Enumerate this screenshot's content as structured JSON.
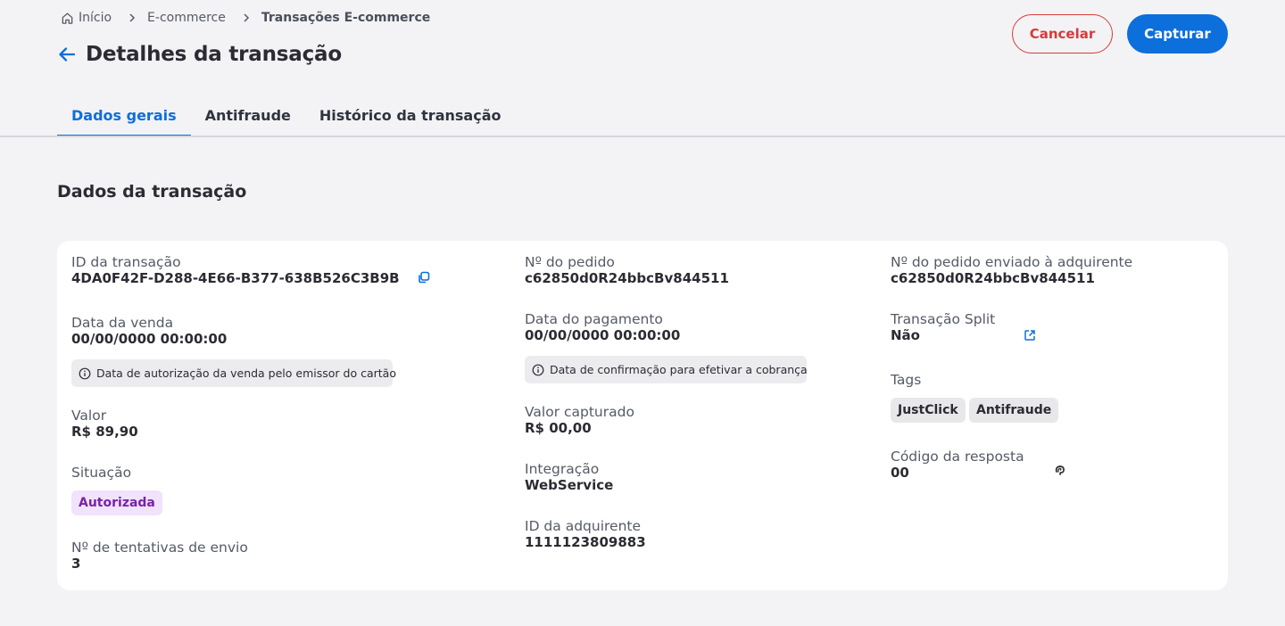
{
  "breadcrumb": {
    "home": "Início",
    "level1": "E-commerce",
    "current": "Transações E-commerce"
  },
  "header": {
    "title": "Detalhes da transação",
    "cancel_label": "Cancelar",
    "capture_label": "Capturar"
  },
  "tabs": [
    {
      "label": "Dados gerais",
      "active": true
    },
    {
      "label": "Antifraude",
      "active": false
    },
    {
      "label": "Histórico da transação",
      "active": false
    }
  ],
  "section": {
    "title": "Dados da transação"
  },
  "col1": {
    "transaction_id_label": "ID da transação",
    "transaction_id": "4DA0F42F-D288-4E66-B377-638B526C3B9B",
    "sale_date_label": "Data da venda",
    "sale_date": "00/00/0000 00:00:00",
    "sale_date_info": "Data de autorização da venda pelo emissor do cartão",
    "amount_label": "Valor",
    "amount": "R$ 89,90",
    "status_label": "Situação",
    "status": "Autorizada",
    "attempts_label": "Nº de tentativas de envio",
    "attempts": "3"
  },
  "col2": {
    "order_label": "Nº do pedido",
    "order": "c62850d0R24bbcBv844511",
    "payment_date_label": "Data do pagamento",
    "payment_date": "00/00/0000 00:00:00",
    "payment_date_info": "Data de confirmação para efetivar a cobrança",
    "captured_label": "Valor capturado",
    "captured": "R$ 00,00",
    "integration_label": "Integração",
    "integration": "WebService",
    "acquirer_id_label": "ID da adquirente",
    "acquirer_id": "1111123809883"
  },
  "col3": {
    "acq_order_label": "Nº do pedido enviado à adquirente",
    "acq_order": "c62850d0R24bbcBv844511",
    "split_label": "Transação Split",
    "split": "Não",
    "tags_label": "Tags",
    "tags": [
      "JustClick",
      "Antifraude"
    ],
    "response_code_label": "Código da resposta",
    "response_code": "00"
  },
  "colors": {
    "primary": "#0c6fdb",
    "danger": "#d63b3b",
    "status_bg": "#f1e3fb",
    "status_text": "#7a21a8"
  },
  "icons": {
    "home": "home-icon",
    "chevron": "chevron-right-icon",
    "back": "arrow-left-icon",
    "copy": "copy-icon",
    "info": "info-icon",
    "external": "external-link-icon",
    "help": "help-icon"
  }
}
